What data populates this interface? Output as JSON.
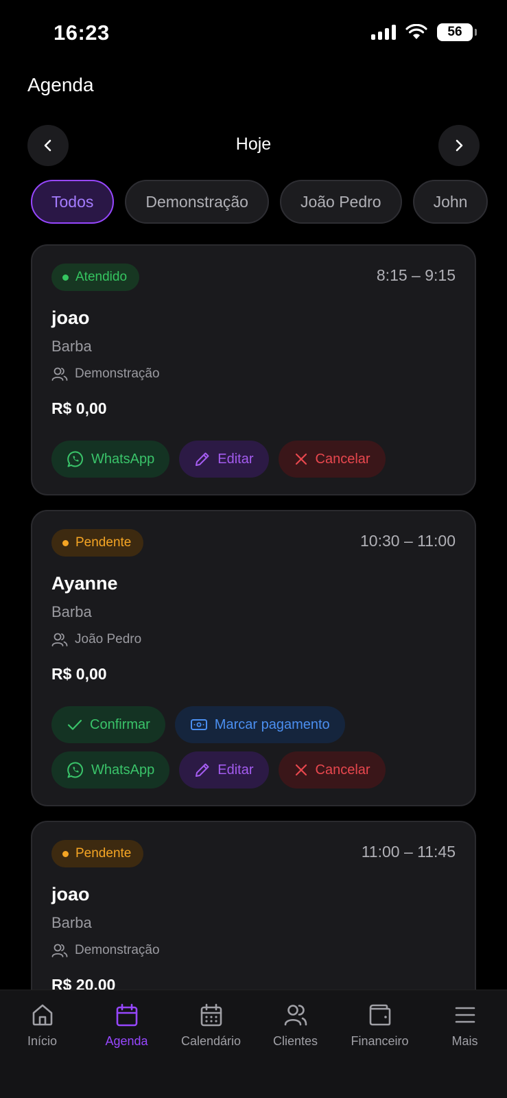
{
  "status_bar": {
    "time": "16:23",
    "battery": "56"
  },
  "header": {
    "title": "Agenda",
    "day_label": "Hoje"
  },
  "filters": [
    {
      "label": "Todos",
      "active": true
    },
    {
      "label": "Demonstração",
      "active": false
    },
    {
      "label": "João Pedro",
      "active": false
    },
    {
      "label": "John",
      "active": false
    }
  ],
  "appointments": [
    {
      "status": "Atendido",
      "time": "8:15 – 9:15",
      "client": "joao",
      "service": "Barba",
      "professional": "Demonstração",
      "price": "R$ 0,00",
      "actions": {
        "whatsapp": "WhatsApp",
        "edit": "Editar",
        "cancel": "Cancelar"
      }
    },
    {
      "status": "Pendente",
      "time": "10:30 – 11:00",
      "client": "Ayanne",
      "service": "Barba",
      "professional": "João Pedro",
      "price": "R$ 0,00",
      "actions": {
        "confirm": "Confirmar",
        "mark_payment": "Marcar pagamento",
        "whatsapp": "WhatsApp",
        "edit": "Editar",
        "cancel": "Cancelar"
      }
    },
    {
      "status": "Pendente",
      "time": "11:00 – 11:45",
      "client": "joao",
      "service": "Barba",
      "professional": "Demonstração",
      "price": "R$ 20,00"
    }
  ],
  "bottom_nav": [
    {
      "label": "Início",
      "icon": "home-icon",
      "active": false
    },
    {
      "label": "Agenda",
      "icon": "calendar-icon",
      "active": true
    },
    {
      "label": "Calendário",
      "icon": "calendar-grid-icon",
      "active": false
    },
    {
      "label": "Clientes",
      "icon": "users-icon",
      "active": false
    },
    {
      "label": "Financeiro",
      "icon": "wallet-icon",
      "active": false
    },
    {
      "label": "Mais",
      "icon": "menu-icon",
      "active": false
    }
  ],
  "colors": {
    "background": "#000000",
    "card": "#1a1a1d",
    "accent": "#9747ff",
    "success": "#35c560",
    "warning": "#f5a524",
    "danger": "#e8474e",
    "info": "#4b8ff0"
  }
}
